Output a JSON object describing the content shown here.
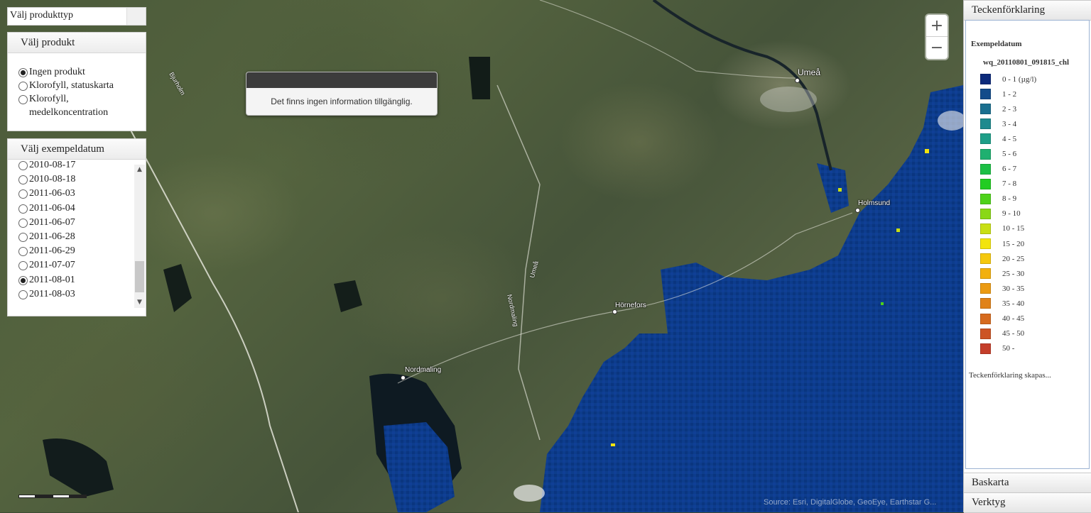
{
  "product_type": {
    "value": "Välj produkttyp"
  },
  "product_panel": {
    "title": "Välj produkt",
    "options": [
      {
        "label": "Ingen produkt",
        "selected": true
      },
      {
        "label": "Klorofyll, statuskarta",
        "selected": false
      },
      {
        "label": "Klorofyll, medelkoncentration",
        "selected": false
      }
    ]
  },
  "date_panel": {
    "title": "Välj exempeldatum",
    "dates": [
      {
        "label": "2010-08-17",
        "selected": false
      },
      {
        "label": "2010-08-18",
        "selected": false
      },
      {
        "label": "2011-06-03",
        "selected": false
      },
      {
        "label": "2011-06-04",
        "selected": false
      },
      {
        "label": "2011-06-07",
        "selected": false
      },
      {
        "label": "2011-06-28",
        "selected": false
      },
      {
        "label": "2011-06-29",
        "selected": false
      },
      {
        "label": "2011-07-07",
        "selected": false
      },
      {
        "label": "2011-08-01",
        "selected": true
      },
      {
        "label": "2011-08-03",
        "selected": false
      }
    ]
  },
  "popup": {
    "message": "Det finns ingen information tillgänglig."
  },
  "map": {
    "zoom_in": "+",
    "zoom_out": "−",
    "attribution": "Source: Esri, DigitalGlobe, GeoEye, Earthstar G...",
    "places": {
      "umea": "Umeå",
      "holmsund": "Holmsund",
      "hornefors": "Hörnefors",
      "nordmaling": "Nordmaling"
    },
    "roads": {
      "bjurholm": "Bjurholm",
      "umea_road": "Umeå",
      "nordmaling_road": "Nordmaling"
    }
  },
  "sidebar": {
    "legend_header": "Teckenförklaring",
    "legend_title": "Exempeldatum",
    "legend_layer": "wq_20110801_091815_chl",
    "legend_status": "Teckenförklaring skapas...",
    "baskarta_header": "Baskarta",
    "verktyg_header": "Verktyg"
  },
  "legend": [
    {
      "label": "0 - 1 (µg/l)",
      "color": "#0c2a7a"
    },
    {
      "label": "1 - 2",
      "color": "#124b8a"
    },
    {
      "label": "2 - 3",
      "color": "#1a6f8f"
    },
    {
      "label": "3 - 4",
      "color": "#1e8a8e"
    },
    {
      "label": "4 - 5",
      "color": "#1e9e88"
    },
    {
      "label": "5 - 6",
      "color": "#1fb070"
    },
    {
      "label": "6 - 7",
      "color": "#1cbf45"
    },
    {
      "label": "7 - 8",
      "color": "#22cc22"
    },
    {
      "label": "8 - 9",
      "color": "#4ed21a"
    },
    {
      "label": "9 - 10",
      "color": "#8ad816"
    },
    {
      "label": "10 - 15",
      "color": "#c8df14"
    },
    {
      "label": "15 - 20",
      "color": "#f2e40e"
    },
    {
      "label": "20 - 25",
      "color": "#f5c80e"
    },
    {
      "label": "25 - 30",
      "color": "#f2b00e"
    },
    {
      "label": "30 - 35",
      "color": "#eb9a12"
    },
    {
      "label": "35 - 40",
      "color": "#e08218"
    },
    {
      "label": "40 - 45",
      "color": "#d66a1e"
    },
    {
      "label": "45 - 50",
      "color": "#cc5424"
    },
    {
      "label": "50 -",
      "color": "#c43e2a"
    }
  ]
}
